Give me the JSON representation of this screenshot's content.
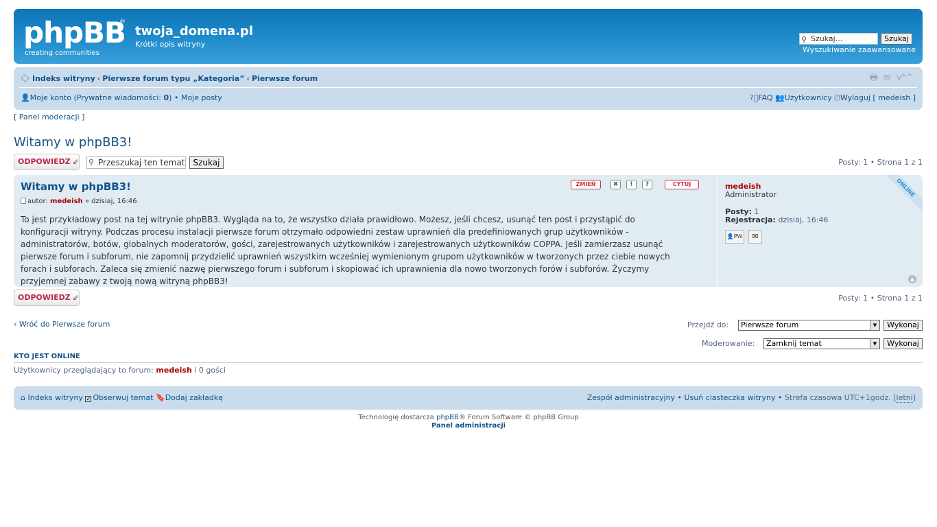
{
  "header": {
    "logo_text": "phpBB",
    "logo_sub": "creating communities",
    "site_name": "twoja_domena.pl",
    "site_desc": "Krótki opis witryny",
    "search_placeholder": "Szukaj…",
    "search_button": "Szukaj",
    "advanced_search": "Wyszukiwanie zaawansowane"
  },
  "navbar": {
    "crumbs": [
      "Indeks witryny",
      "Pierwsze forum typu „Kategoria”",
      "Pierwsze forum"
    ],
    "my_account": "Moje konto",
    "pm_label": "Prywatne wiadomości: ",
    "pm_count": "0",
    "my_posts": "Moje posty",
    "faq": "FAQ",
    "users": "Użytkownicy",
    "logout": "Wyloguj [ medeish ]"
  },
  "mod_panel": "[ Panel moderacji ]",
  "topic": {
    "title": "Witamy w phpBB3!",
    "reply_label": "ODPOWIEDZ",
    "search_topic_value": "Przeszukaj ten temat",
    "search_topic_button": "Szukaj",
    "pagination_text": "Posty: 1 • Strona 1 z 1",
    "pagination_posts": "Posty: 1",
    "pagination_page": "Strona 1 z 1"
  },
  "post": {
    "title": "Witamy w phpBB3!",
    "author_prefix": "autor:",
    "author": "medeish",
    "date": "» dzisiaj, 16:46",
    "buttons": {
      "edit": "ZMIEŃ",
      "delete": "✖",
      "report": "!",
      "info": "?",
      "quote": "CYTUJ"
    },
    "text": "To jest przykładowy post na tej witrynie phpBB3. Wygląda na to, że wszystko działa prawidłowo. Możesz, jeśli chcesz, usunąć ten post i przystąpić do konfiguracji witryny. Podczas procesu instalacji pierwsze forum otrzymało odpowiedni zestaw uprawnień dla predefiniowanych grup użytkowników - administratorów, botów, globalnych moderatorów, gości, zarejestrowanych użytkowników i zarejestrowanych użytkowników COPPA. Jeśli zamierzasz usunąć pierwsze forum i subforum, nie zapomnij przydzielić uprawnień wszystkim wcześniej wymienionym grupom użytkowników w tworzonych przez ciebie nowych forach i subforach. Zaleca się zmienić nazwę pierwszego forum i subforum i skopiować ich uprawnienia dla nowo tworzonych forów i subforów. Życzymy przyjemnej zabawy z twoją nową witryną phpBB3!",
    "profile": {
      "name": "medeish",
      "rank": "Administrator",
      "posts_label": "Posty:",
      "posts_value": "1",
      "reg_label": "Rejestracja:",
      "reg_value": "dzisiaj, 16:46",
      "pm_button": "PW",
      "online_badge": "ONLINE"
    }
  },
  "bottom": {
    "back_link": "Wróć do Pierwsze forum",
    "jump_label": "Przejdź do:",
    "jump_value": "Pierwsze forum",
    "jump_button": "Wykonaj",
    "mod_label": "Moderowanie:",
    "mod_value": "Zamknij temat",
    "mod_button": "Wykonaj"
  },
  "online": {
    "heading": "KTO JEST ONLINE",
    "text_prefix": "Użytkownicy przeglądający to forum:",
    "user": "medeish",
    "text_suffix": "i 0 gości"
  },
  "footer": {
    "index": "Indeks witryny",
    "watch": "Obserwuj temat",
    "bookmark": "Dodaj zakładkę",
    "team": "Zespół administracyjny",
    "delete_cookies": "Usuń ciasteczka witryny",
    "timezone": "Strefa czasowa UTC+1godz. [",
    "dst": "letni",
    "timezone_end": "]"
  },
  "copyright": {
    "prefix": "Technologię dostarcza",
    "link": "phpBB",
    "suffix": "® Forum Software © phpBB Group",
    "admin_panel": "Panel administracji"
  }
}
